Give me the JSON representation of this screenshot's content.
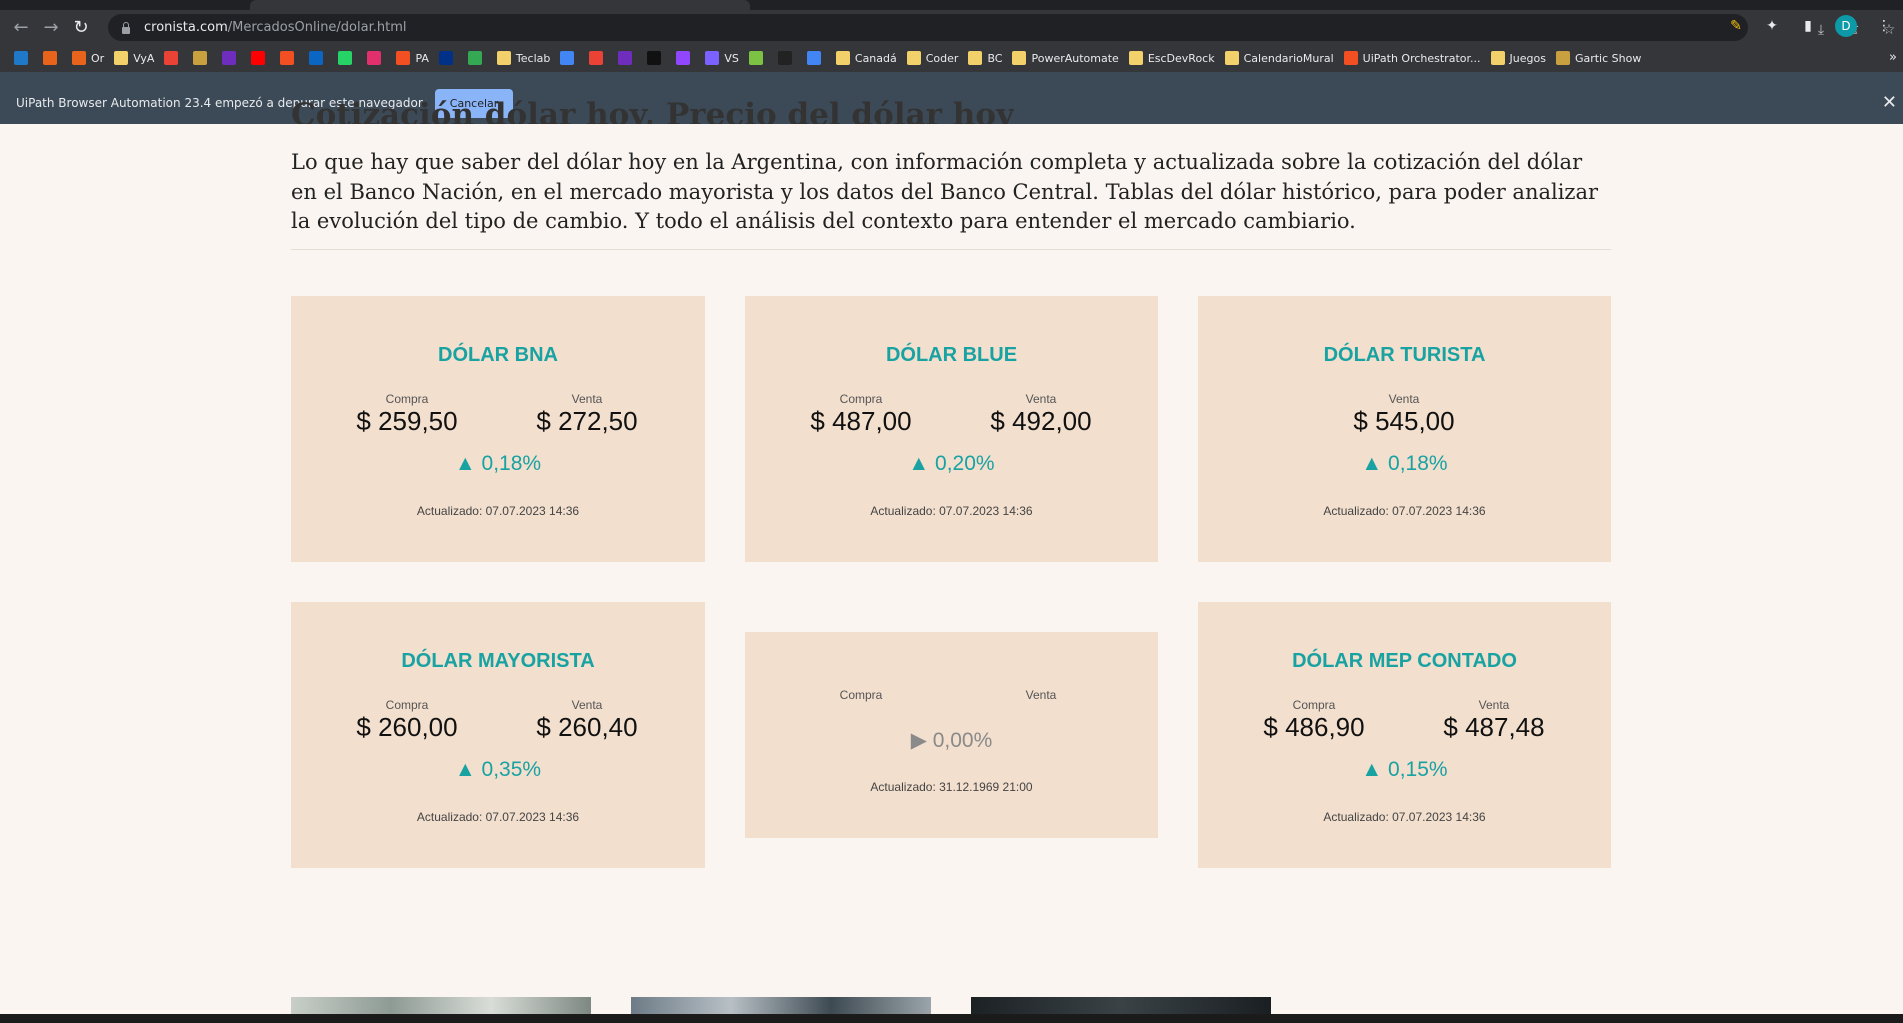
{
  "browser": {
    "url_host": "cronista.com",
    "url_path": "/MercadosOnline/dolar.html",
    "profile_initial": "D"
  },
  "bookmarks": [
    {
      "label": "",
      "color": "#1f78c8"
    },
    {
      "label": "",
      "color": "#e8641c"
    },
    {
      "label": "Or",
      "color": "#e8641c"
    },
    {
      "label": "VyA",
      "color": "#f2d16b"
    },
    {
      "label": "",
      "color": "#ea4335"
    },
    {
      "label": "",
      "color": "#c8a040"
    },
    {
      "label": "",
      "color": "#6f2dbd"
    },
    {
      "label": "",
      "color": "#ff0000"
    },
    {
      "label": "",
      "color": "#f25022"
    },
    {
      "label": "",
      "color": "#0a66c2"
    },
    {
      "label": "",
      "color": "#25d366"
    },
    {
      "label": "",
      "color": "#e1306c"
    },
    {
      "label": "PA",
      "color": "#f25022"
    },
    {
      "label": "",
      "color": "#003087"
    },
    {
      "label": "",
      "color": "#34a853"
    },
    {
      "label": "Teclab",
      "color": "#f2d16b"
    },
    {
      "label": "",
      "color": "#4285f4"
    },
    {
      "label": "",
      "color": "#ea4335"
    },
    {
      "label": "",
      "color": "#6f2dbd"
    },
    {
      "label": "",
      "color": "#111111"
    },
    {
      "label": "",
      "color": "#9146ff"
    },
    {
      "label": "VS",
      "color": "#7b61ff"
    },
    {
      "label": "",
      "color": "#7cc243"
    },
    {
      "label": "",
      "color": "#222222"
    },
    {
      "label": "",
      "color": "#4285f4"
    },
    {
      "label": "Canadá",
      "color": "#f2d16b"
    },
    {
      "label": "Coder",
      "color": "#f2d16b"
    },
    {
      "label": "BC",
      "color": "#f2d16b"
    },
    {
      "label": "PowerAutomate",
      "color": "#f2d16b"
    },
    {
      "label": "EscDevRock",
      "color": "#f2d16b"
    },
    {
      "label": "CalendarioMural",
      "color": "#f2d16b"
    },
    {
      "label": "UiPath Orchestrator...",
      "color": "#f25022"
    },
    {
      "label": "Juegos",
      "color": "#f2d16b"
    },
    {
      "label": "Gartic Show",
      "color": "#c8a040"
    }
  ],
  "bookmarks_more": "»",
  "infobar": {
    "message": "UiPath Browser Automation 23.4 empezó a depurar este navegador",
    "cancel_label": "Cancelar",
    "close": "✕"
  },
  "page": {
    "title": "Cotización dólar hoy, Precio del dólar hoy",
    "intro": "Lo que hay que saber del dólar hoy en la Argentina, con información completa y actualizada sobre la cotización del dólar en el Banco Nación, en el mercado mayorista y los datos del Banco Central. Tablas del dólar histórico, para poder analizar la evolución del tipo de cambio. Y todo el análisis del contexto para entender el mercado cambiario."
  },
  "cards": [
    {
      "title": "DÓLAR BNA",
      "buy_label": "Compra",
      "buy": "$ 259,50",
      "sell_label": "Venta",
      "sell": "$ 272,50",
      "change": "▲ 0,18%",
      "updated": "Actualizado: 07.07.2023 14:36"
    },
    {
      "title": "DÓLAR BLUE",
      "buy_label": "Compra",
      "buy": "$ 487,00",
      "sell_label": "Venta",
      "sell": "$ 492,00",
      "change": "▲ 0,20%",
      "updated": "Actualizado: 07.07.2023 14:36"
    },
    {
      "title": "DÓLAR TURISTA",
      "sell_label": "Venta",
      "sell": "$ 545,00",
      "change": "▲ 0,18%",
      "updated": "Actualizado: 07.07.2023 14:36"
    },
    {
      "title": "DÓLAR MAYORISTA",
      "buy_label": "Compra",
      "buy": "$ 260,00",
      "sell_label": "Venta",
      "sell": "$ 260,40",
      "change": "▲ 0,35%",
      "updated": "Actualizado: 07.07.2023 14:36"
    },
    {
      "title": "",
      "buy_label": "Compra",
      "sell_label": "Venta",
      "change": "▶ 0,00%",
      "updated": "Actualizado: 31.12.1969 21:00"
    },
    {
      "title": "DÓLAR MEP CONTADO",
      "buy_label": "Compra",
      "buy": "$ 486,90",
      "sell_label": "Venta",
      "sell": "$ 487,48",
      "change": "▲ 0,15%",
      "updated": "Actualizado: 07.07.2023 14:36"
    }
  ],
  "colors": {
    "accent": "#19a2a2",
    "card_bg": "#f2dfce",
    "page_bg": "#faf5f0"
  }
}
